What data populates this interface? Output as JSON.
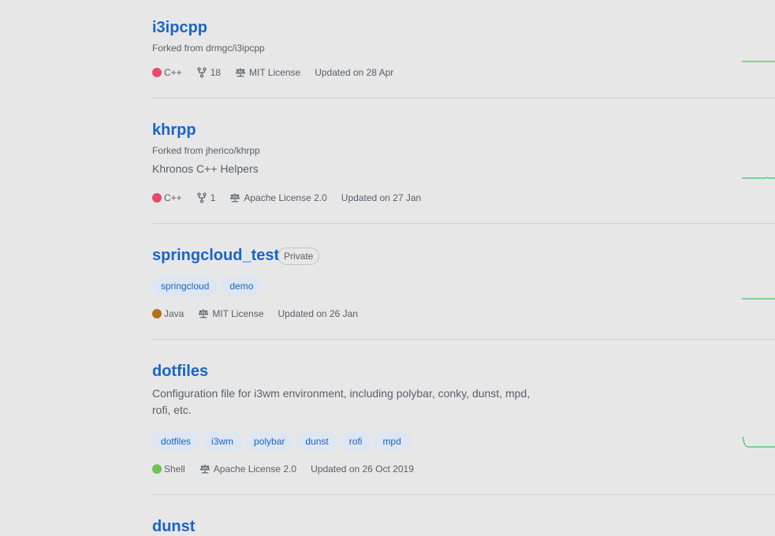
{
  "repos": [
    {
      "name": "i3ipcpp",
      "forked": "Forked from drmgc/i3ipcpp",
      "language": "C++",
      "language_color": "#e34c6b",
      "forks": "18",
      "license": "MIT License",
      "updated": "Updated on 28 Apr"
    },
    {
      "name": "khrpp",
      "forked": "Forked from jherico/khrpp",
      "description": "Khronos C++ Helpers",
      "language": "C++",
      "language_color": "#e34c6b",
      "forks": "1",
      "license": "Apache License 2.0",
      "updated": "Updated on 27 Jan"
    },
    {
      "name": "springcloud_test",
      "badge": "Private",
      "topics": [
        "springcloud",
        "demo"
      ],
      "language": "Java",
      "language_color": "#b07219",
      "license": "MIT License",
      "updated": "Updated on 26 Jan"
    },
    {
      "name": "dotfiles",
      "description": "Configuration file for i3wm environment, including polybar, conky, dunst, mpd, rofi, etc.",
      "topics": [
        "dotfiles",
        "i3wm",
        "polybar",
        "dunst",
        "rofi",
        "mpd"
      ],
      "language": "Shell",
      "language_color": "#6ec155",
      "license": "Apache License 2.0",
      "updated": "Updated on 26 Oct 2019"
    },
    {
      "name": "dunst"
    }
  ],
  "icons": {
    "fork": "repo-forked-icon",
    "license": "law-icon"
  },
  "colors": {
    "link": "#1a64c9",
    "sparkline": "#40c463",
    "topic_bg": "#dde6f1"
  }
}
